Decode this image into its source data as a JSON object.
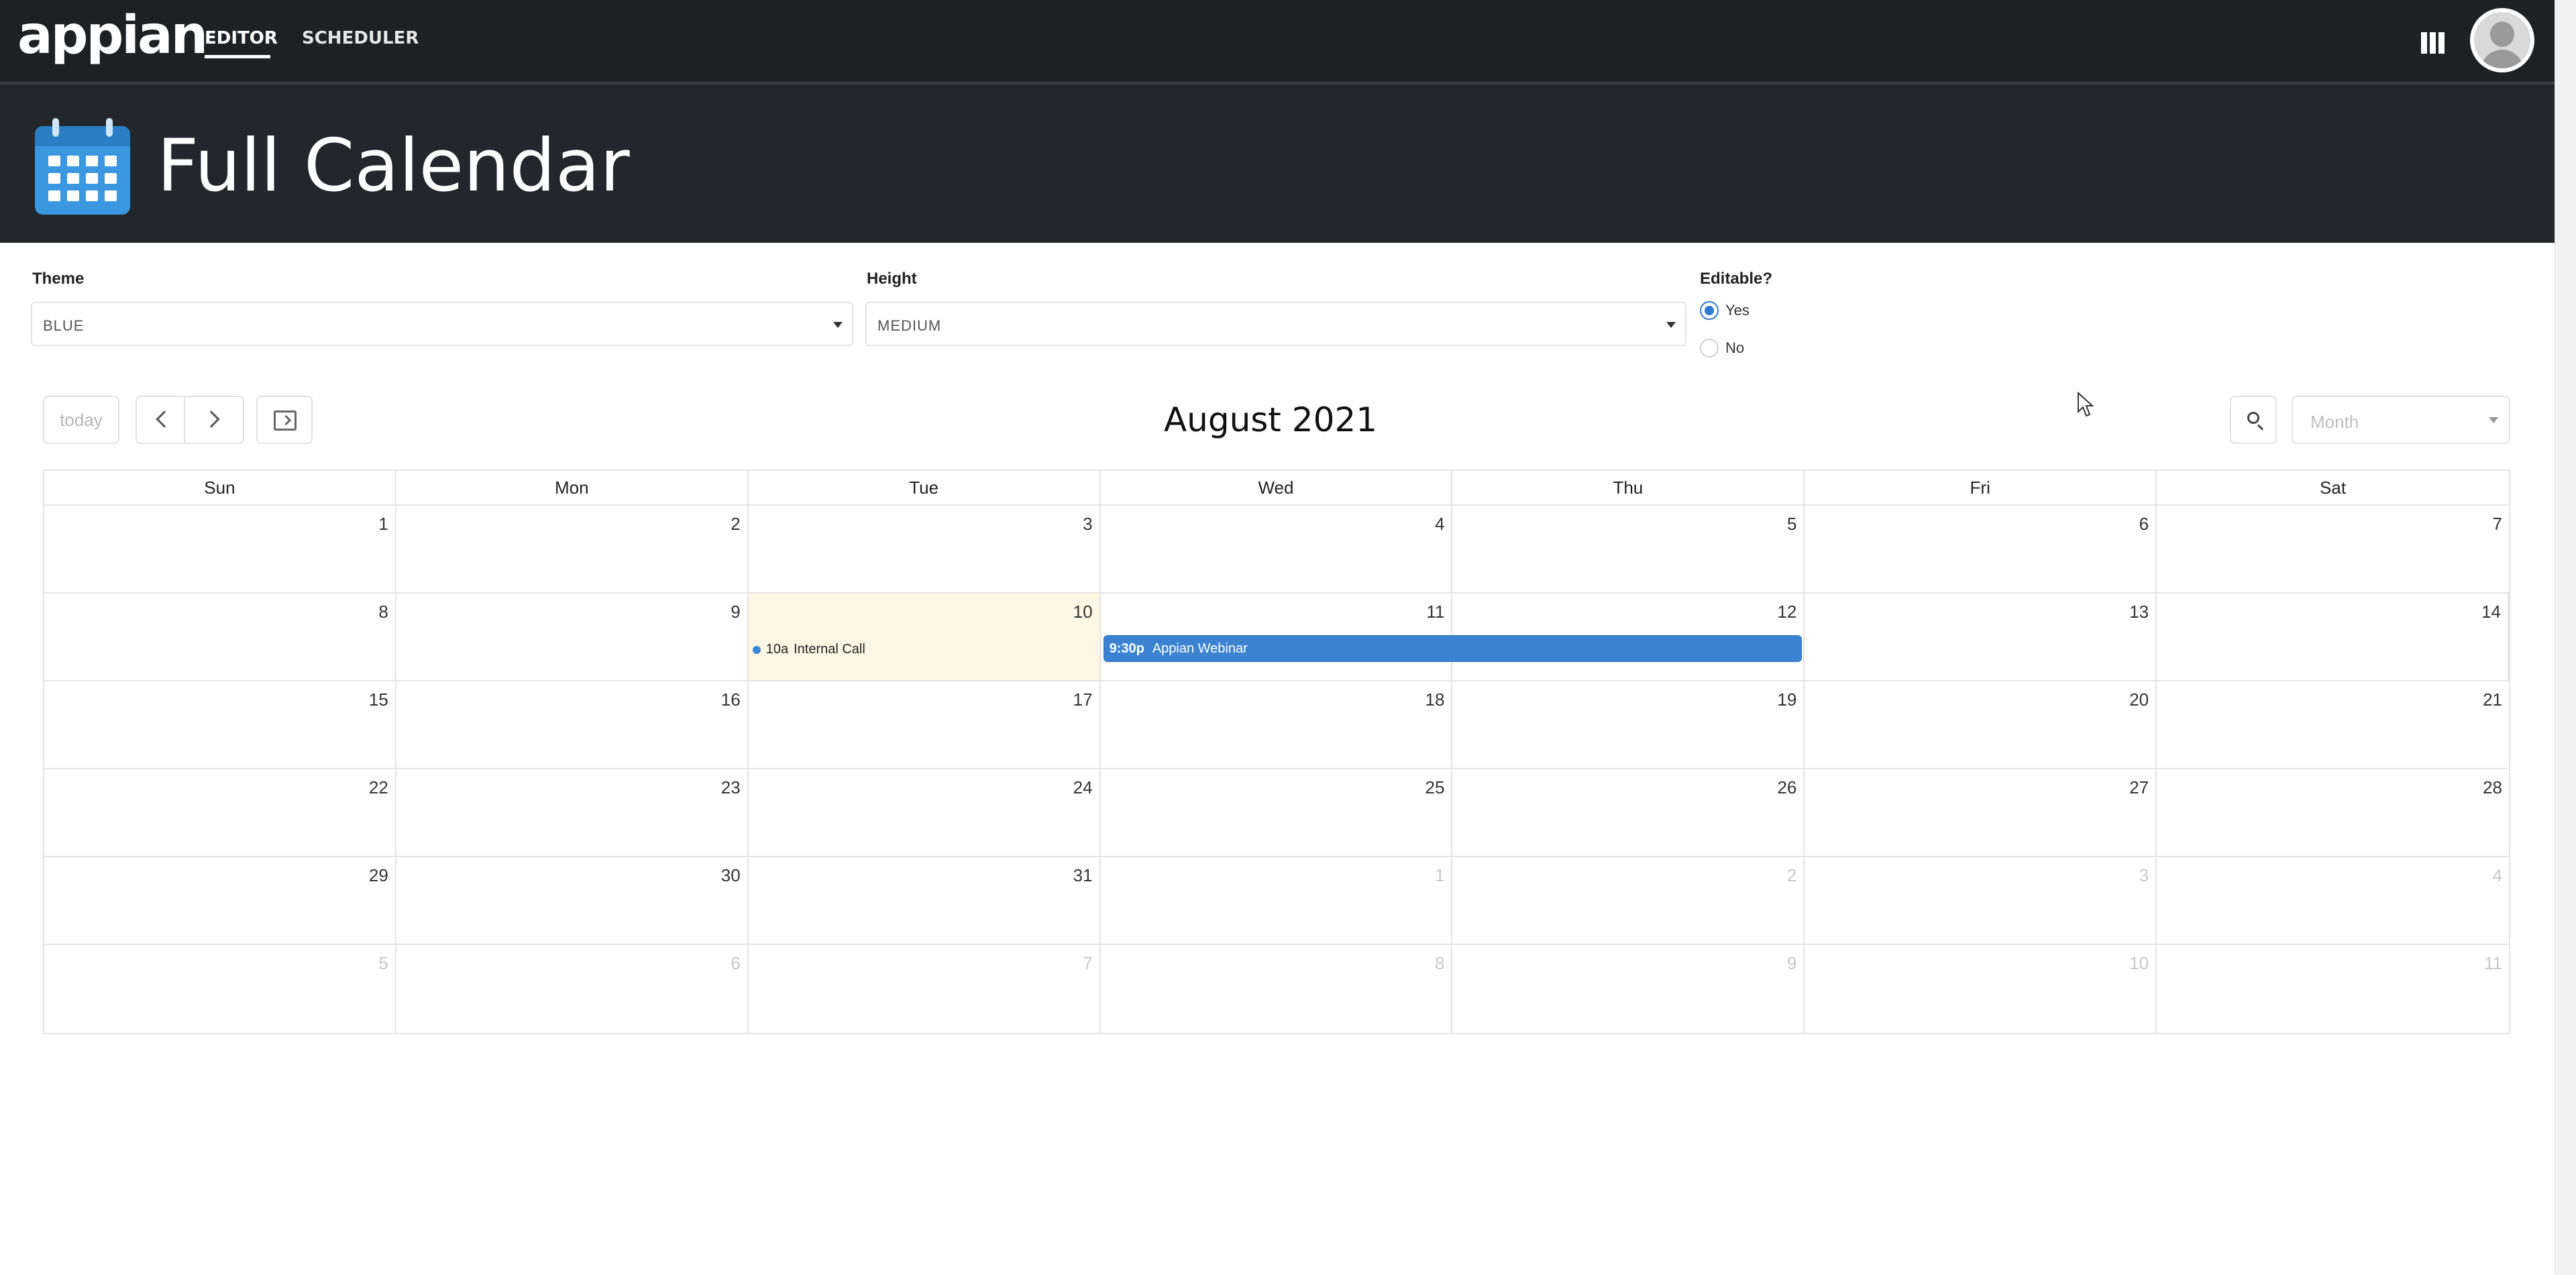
{
  "nav": {
    "logo": "appian",
    "tabs": [
      {
        "label": "EDITOR",
        "active": true
      },
      {
        "label": "SCHEDULER",
        "active": false
      }
    ],
    "icons": [
      "apps-grid-icon",
      "user-avatar"
    ]
  },
  "header": {
    "icon": "calendar-icon",
    "title": "Full Calendar"
  },
  "form": {
    "theme": {
      "label": "Theme",
      "value": "BLUE"
    },
    "height": {
      "label": "Height",
      "value": "MEDIUM"
    },
    "editable": {
      "label": "Editable?",
      "options": [
        {
          "label": "Yes",
          "checked": true
        },
        {
          "label": "No",
          "checked": false
        }
      ]
    }
  },
  "toolbar": {
    "today_label": "today",
    "title": "August 2021",
    "view": "Month"
  },
  "calendar": {
    "weekdays": [
      "Sun",
      "Mon",
      "Tue",
      "Wed",
      "Thu",
      "Fri",
      "Sat"
    ],
    "weeks": [
      [
        {
          "n": "1"
        },
        {
          "n": "2"
        },
        {
          "n": "3"
        },
        {
          "n": "4"
        },
        {
          "n": "5"
        },
        {
          "n": "6"
        },
        {
          "n": "7"
        }
      ],
      [
        {
          "n": "8"
        },
        {
          "n": "9"
        },
        {
          "n": "10",
          "today": true
        },
        {
          "n": "11"
        },
        {
          "n": "12"
        },
        {
          "n": "13"
        },
        {
          "n": "14"
        }
      ],
      [
        {
          "n": "15"
        },
        {
          "n": "16"
        },
        {
          "n": "17"
        },
        {
          "n": "18"
        },
        {
          "n": "19"
        },
        {
          "n": "20"
        },
        {
          "n": "21"
        }
      ],
      [
        {
          "n": "22"
        },
        {
          "n": "23"
        },
        {
          "n": "24"
        },
        {
          "n": "25"
        },
        {
          "n": "26"
        },
        {
          "n": "27"
        },
        {
          "n": "28"
        }
      ],
      [
        {
          "n": "29"
        },
        {
          "n": "30"
        },
        {
          "n": "31"
        },
        {
          "n": "1",
          "other": true
        },
        {
          "n": "2",
          "other": true
        },
        {
          "n": "3",
          "other": true
        },
        {
          "n": "4",
          "other": true
        }
      ],
      [
        {
          "n": "5",
          "other": true
        },
        {
          "n": "6",
          "other": true
        },
        {
          "n": "7",
          "other": true
        },
        {
          "n": "8",
          "other": true
        },
        {
          "n": "9",
          "other": true
        },
        {
          "n": "10",
          "other": true
        },
        {
          "n": "11",
          "other": true
        }
      ]
    ],
    "events": [
      {
        "type": "dot",
        "week": 1,
        "day": 2,
        "time": "10a",
        "title": "Internal Call",
        "color": "#3788d8"
      },
      {
        "type": "bar",
        "week": 1,
        "day": 3,
        "span": 2,
        "time": "9:30p",
        "title": "Appian Webinar",
        "color": "#3b82d0"
      }
    ]
  }
}
